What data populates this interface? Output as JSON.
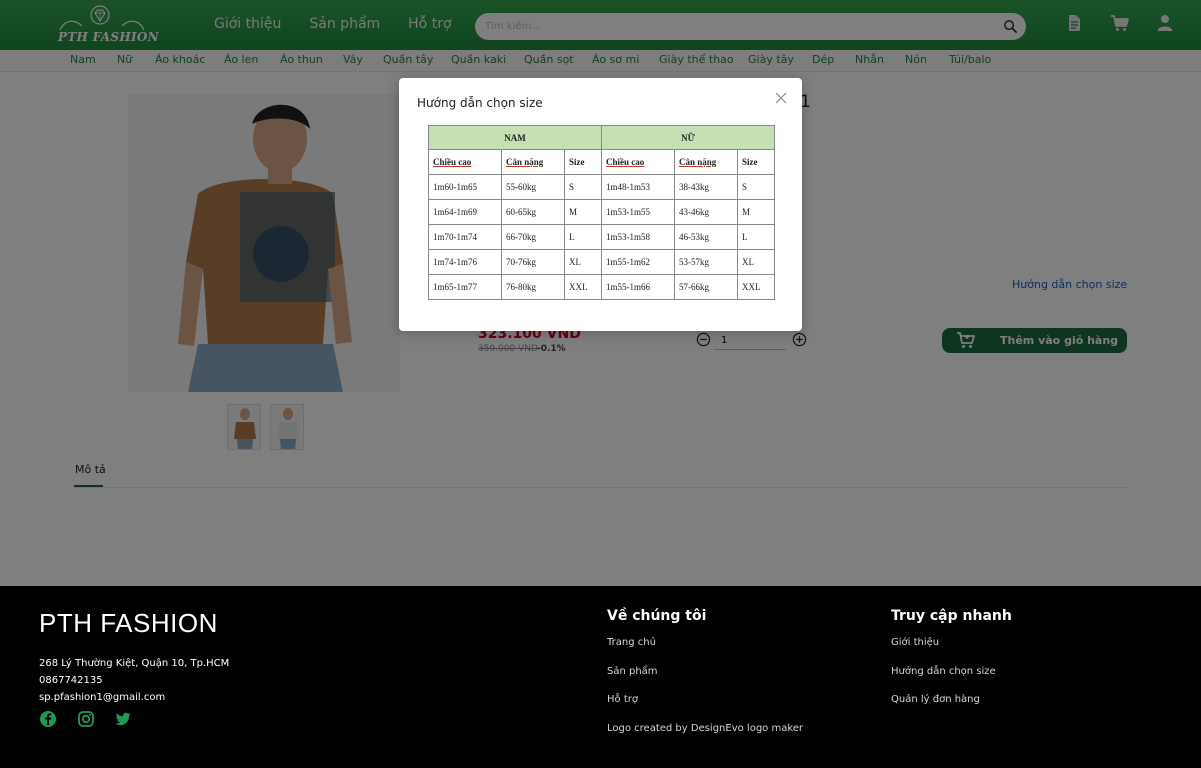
{
  "header": {
    "logo_text": "PTH FASHION",
    "nav": [
      "Giới thiệu",
      "Sản phẩm",
      "Hỗ trợ"
    ],
    "search_placeholder": "Tìm kiếm...",
    "icons": [
      "search-icon",
      "document-icon",
      "cart-icon",
      "user-icon"
    ],
    "accent_color": "#2a9a4a"
  },
  "categories": [
    "Nam",
    "Nữ",
    "Áo khoác",
    "Áo len",
    "Áo thun",
    "Váy",
    "Quần tây",
    "Quần kaki",
    "Quần sọt",
    "Áo sơ mi",
    "Giày thể thao",
    "Giày tây",
    "Dép",
    "Nhẫn",
    "Nón",
    "Túi/balo"
  ],
  "product": {
    "title_peek": "1",
    "price": "323.100 VND",
    "old_price": "359.000 VND",
    "discount": "-0.1%",
    "quantity": "1",
    "size_guide_link": "Hướng dẫn chọn size",
    "add_to_cart": "Thêm vào giỏ hàng",
    "tab_description": "Mô tả"
  },
  "modal": {
    "title": "Hướng dẫn chọn size",
    "groups": [
      "NAM",
      "NỮ"
    ],
    "columns": [
      "Chiều cao",
      "Cân nặng",
      "Size",
      "Chiều cao",
      "Cân nặng",
      "Size"
    ],
    "rows": [
      [
        "1m60-1m65",
        "55-60kg",
        "S",
        "1m48-1m53",
        "38-43kg",
        "S"
      ],
      [
        "1m64-1m69",
        "60-65kg",
        "M",
        "1m53-1m55",
        "43-46kg",
        "M"
      ],
      [
        "1m70-1m74",
        "66-70kg",
        "L",
        "1m53-1m58",
        "46-53kg",
        "L"
      ],
      [
        "1m74-1m76",
        "70-76kg",
        "XL",
        "1m55-1m62",
        "53-57kg",
        "XL"
      ],
      [
        "1m65-1m77",
        "76-80kg",
        "XXL",
        "1m55-1m66",
        "57-66kg",
        "XXL"
      ]
    ]
  },
  "footer": {
    "brand": "PTH FASHION",
    "address": "268 Lý Thường Kiệt, Quận 10, Tp.HCM",
    "phone": "0867742135",
    "email": "sp.pfashion1@gmail.com",
    "social": [
      "facebook-icon",
      "instagram-icon",
      "twitter-icon"
    ],
    "about_title": "Về chúng tôi",
    "about_links": [
      "Trang chủ",
      "Sản phẩm",
      "Hỗ trợ",
      "Logo created by DesignEvo logo maker"
    ],
    "quick_title": "Truy cập nhanh",
    "quick_links": [
      "Giới thiệu",
      "Hướng dẫn chọn size",
      "Quản lý đơn hàng"
    ]
  }
}
